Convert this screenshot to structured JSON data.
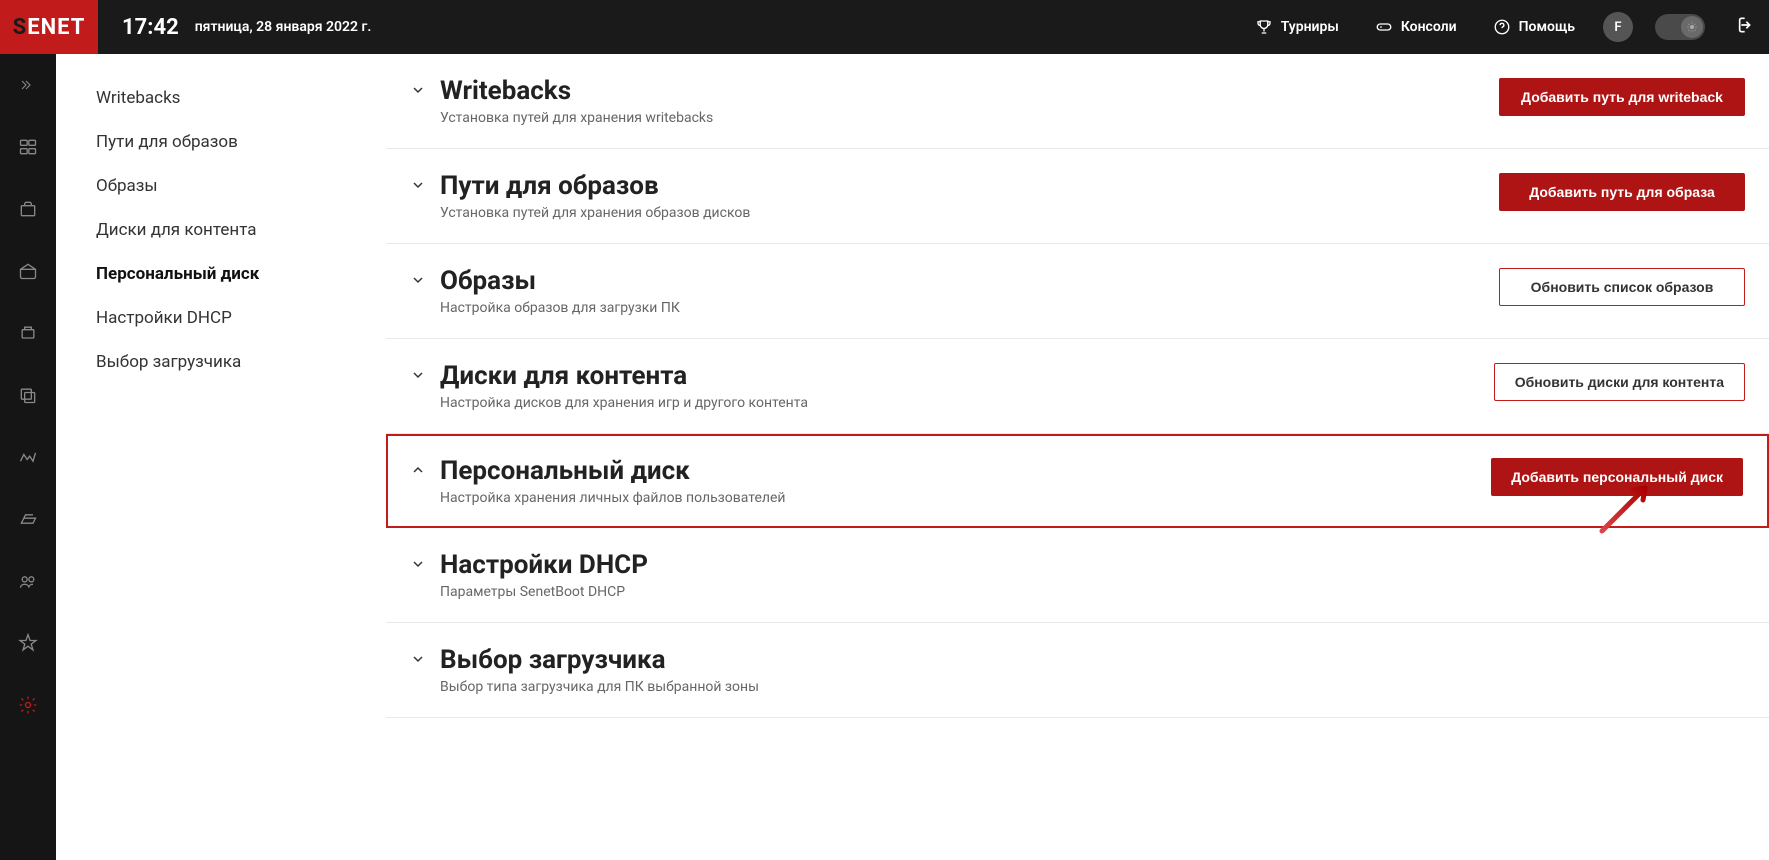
{
  "brand": "SENET",
  "time": "17:42",
  "date": "пятница, 28 января 2022 г.",
  "topnav": {
    "tournaments": "Турниры",
    "consoles": "Консоли",
    "help": "Помощь"
  },
  "avatar_letter": "F",
  "subnav": [
    {
      "label": "Writebacks",
      "active": false
    },
    {
      "label": "Пути для образов",
      "active": false
    },
    {
      "label": "Образы",
      "active": false
    },
    {
      "label": "Диски для контента",
      "active": false
    },
    {
      "label": "Персональный диск",
      "active": true
    },
    {
      "label": "Настройки DHCP",
      "active": false
    },
    {
      "label": "Выбор загрузчика",
      "active": false
    }
  ],
  "sections": [
    {
      "title": "Writebacks",
      "sub": "Установка путей для хранения writebacks",
      "button": "Добавить путь для writeback",
      "button_style": "primary",
      "expanded": false,
      "highlighted": false
    },
    {
      "title": "Пути для образов",
      "sub": "Установка путей для хранения образов дисков",
      "button": "Добавить путь для образа",
      "button_style": "primary",
      "expanded": false,
      "highlighted": false
    },
    {
      "title": "Образы",
      "sub": "Настройка образов для загрузки ПК",
      "button": "Обновить список образов",
      "button_style": "outline",
      "expanded": false,
      "highlighted": false
    },
    {
      "title": "Диски для контента",
      "sub": "Настройка дисков для хранения игр и другого контента",
      "button": "Обновить диски для контента",
      "button_style": "outline",
      "expanded": false,
      "highlighted": false
    },
    {
      "title": "Персональный диск",
      "sub": "Настройка хранения личных файлов пользователей",
      "button": "Добавить персональный диск",
      "button_style": "primary",
      "expanded": true,
      "highlighted": true
    },
    {
      "title": "Настройки DHCP",
      "sub": "Параметры SenetBoot DHCP",
      "button": null,
      "button_style": null,
      "expanded": false,
      "highlighted": false
    },
    {
      "title": "Выбор загрузчика",
      "sub": "Выбор типа загрузчика для ПК выбранной зоны",
      "button": null,
      "button_style": null,
      "expanded": false,
      "highlighted": false
    }
  ]
}
